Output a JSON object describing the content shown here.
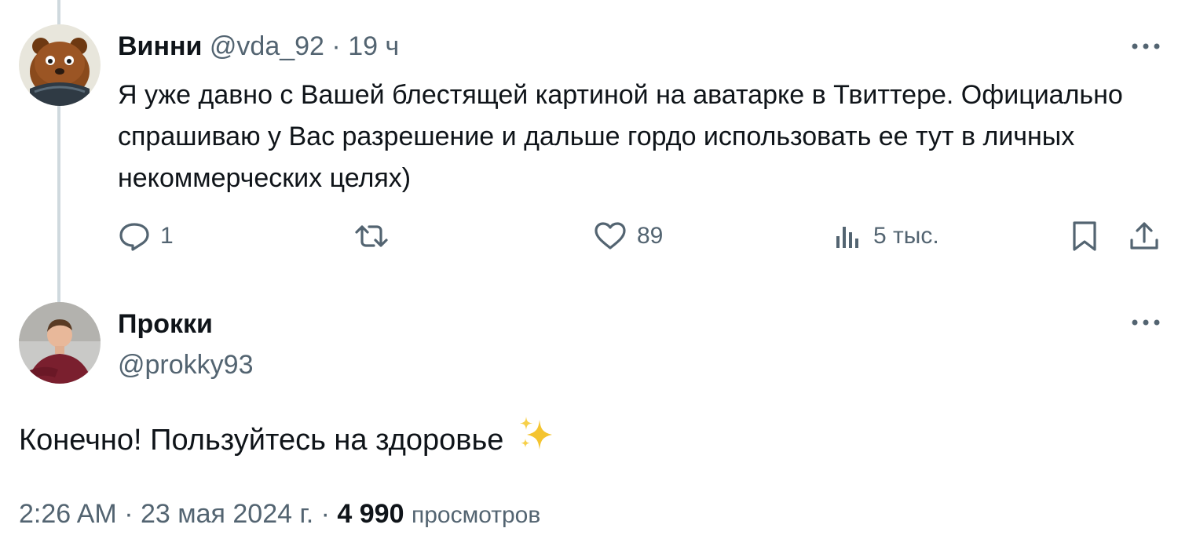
{
  "reply_tweet": {
    "author": {
      "display_name": "Винни",
      "handle": "@vda_92",
      "separator": "·",
      "time": "19 ч"
    },
    "text": "Я уже давно с Вашей блестящей картиной на аватарке в Твиттере. Официально спрашиваю у Вас разрешение и дальше гордо использовать ее тут в личных некоммерческих целях)",
    "actions": {
      "replies": "1",
      "retweets": "",
      "likes": "89",
      "views": "5 тыс."
    },
    "icons": [
      "more-icon",
      "reply-icon",
      "retweet-icon",
      "like-icon",
      "views-icon",
      "bookmark-icon",
      "share-icon"
    ]
  },
  "main_tweet": {
    "author": {
      "display_name": "Прокки",
      "handle": "@prokky93"
    },
    "text": "Конечно! Пользуйтесь на здоровье",
    "emoji": "sparkles-emoji",
    "meta": {
      "time": "2:26 AM",
      "separator1": "·",
      "date": "23 мая 2024 г.",
      "separator2": "·",
      "views_count": "4 990",
      "views_label": "просмотров"
    }
  },
  "colors": {
    "text_primary": "#0f1419",
    "text_secondary": "#536471",
    "thread_line": "#cfd9de",
    "sparkle": "#f4c430"
  }
}
